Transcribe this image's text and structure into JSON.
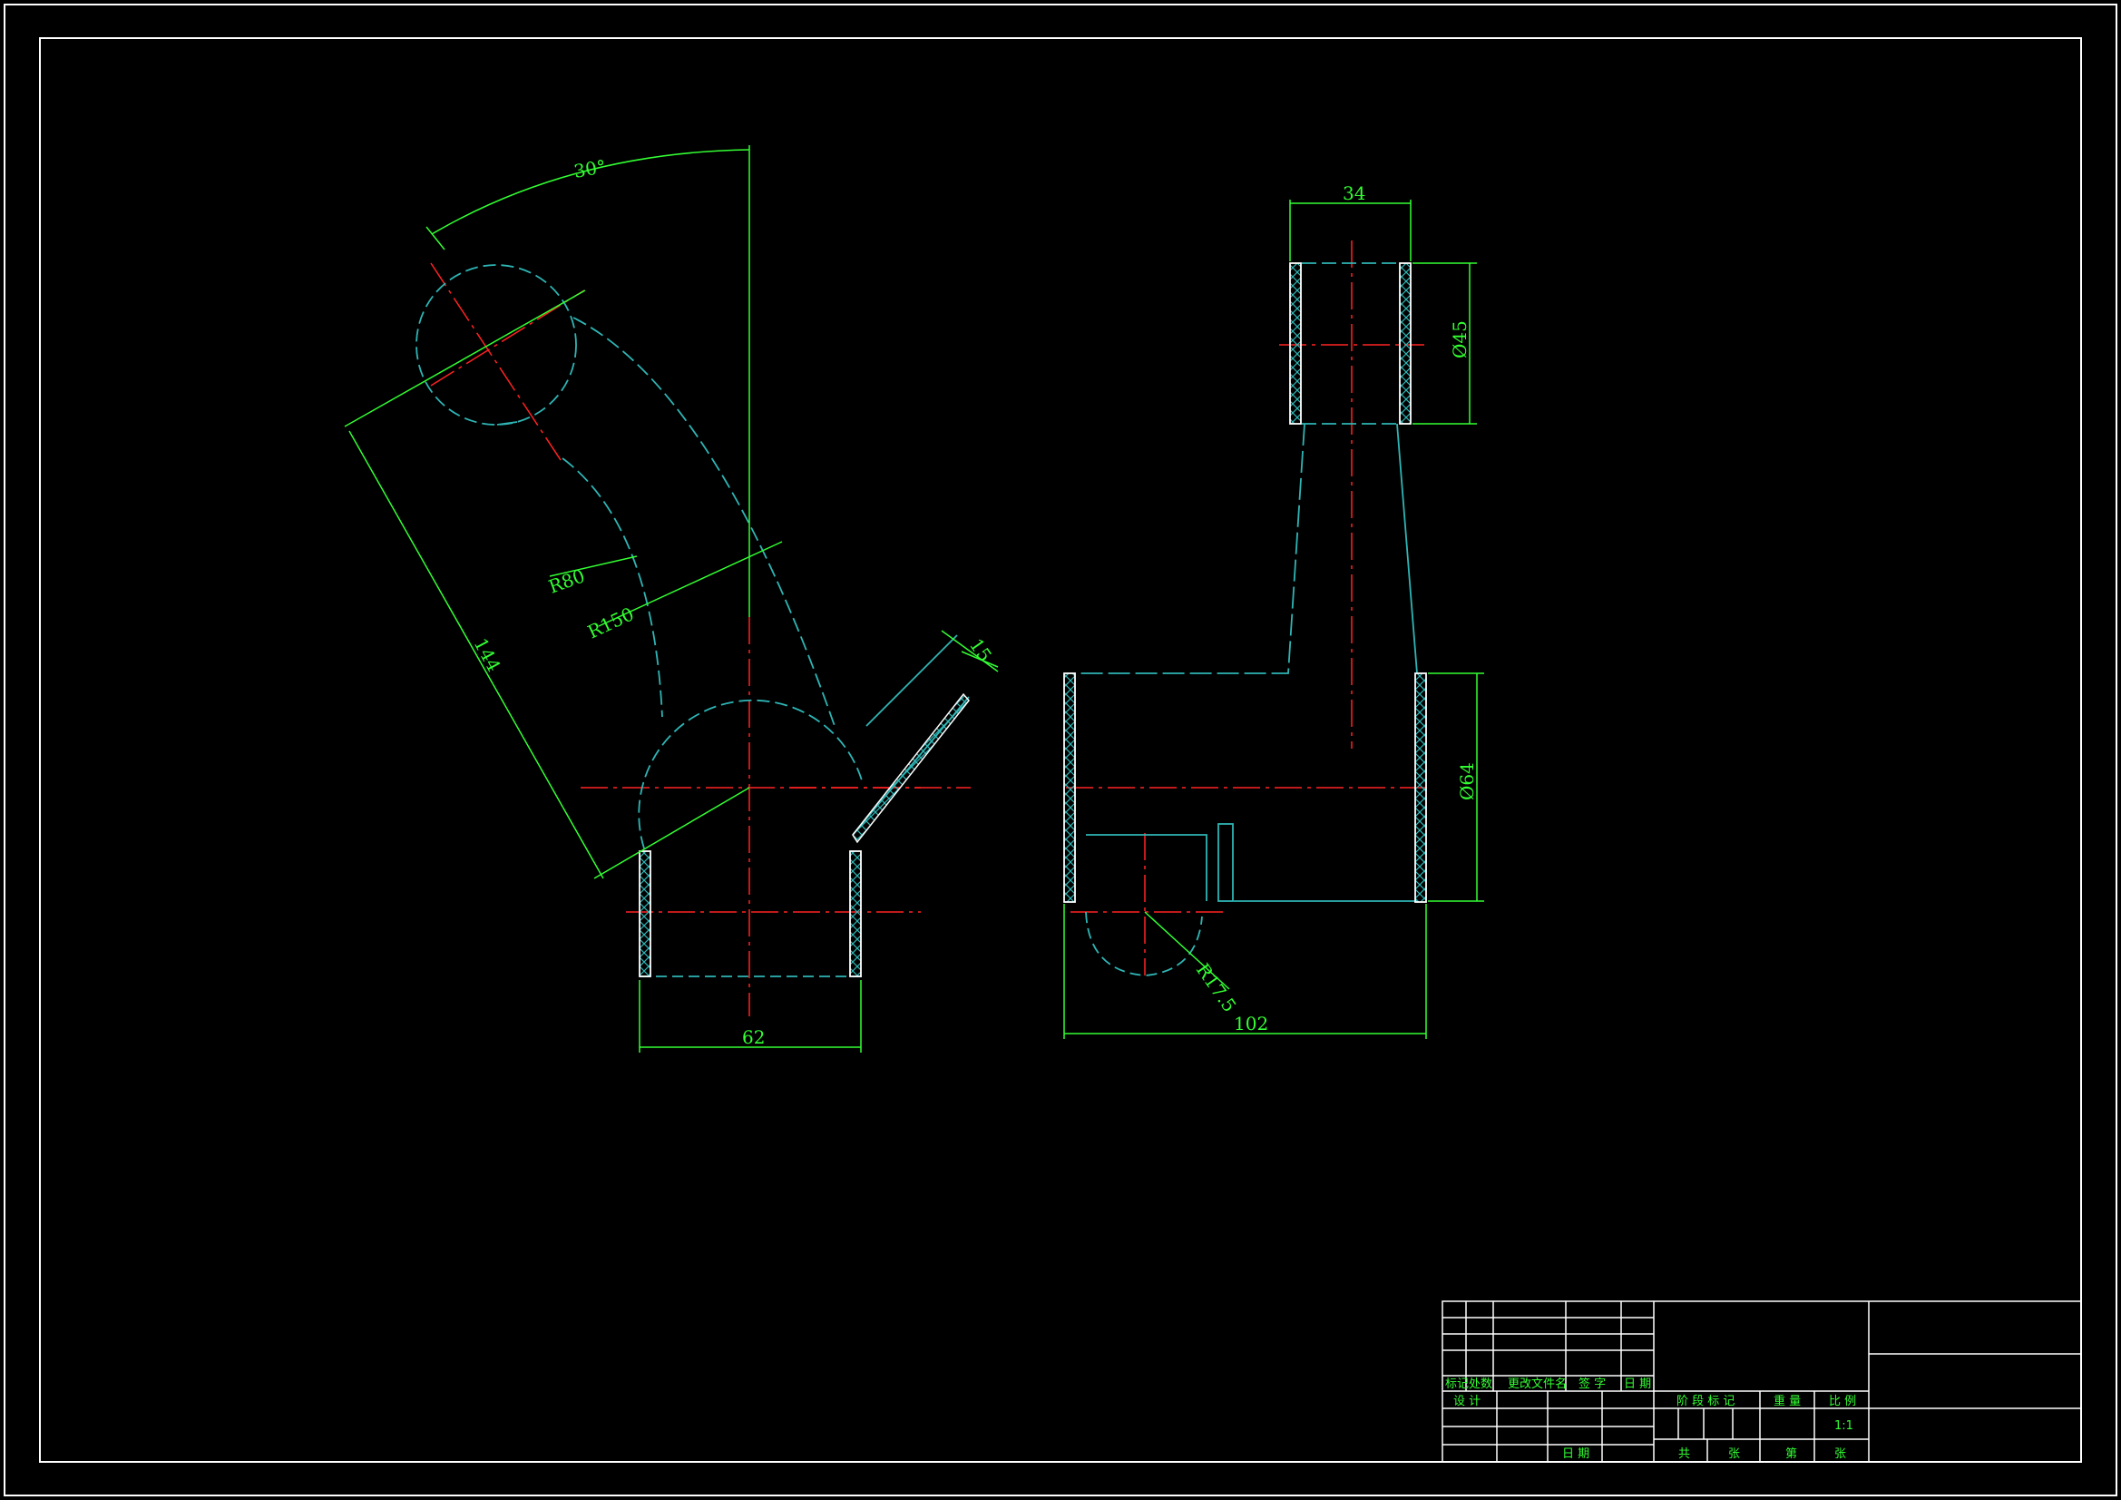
{
  "dimensions": {
    "angle": "30°",
    "r80": "R80",
    "r150": "R150",
    "len144": "144",
    "w15": "15",
    "w62": "62",
    "w34": "34",
    "d45": "Ø45",
    "d64": "Ø64",
    "r17": "R17.5",
    "w102": "102"
  },
  "title_block": {
    "mark": "标记",
    "count": "处数",
    "change_doc": "更改文件名",
    "sign": "签 字",
    "date": "日 期",
    "design": "设 计",
    "stage_mark": "阶 段 标 记",
    "weight": "重 量",
    "scale": "比 例",
    "scale_value": "1:1",
    "date2": "日 期",
    "total": "共",
    "sheets": "张",
    "sheet_no": "第",
    "sheet": "张"
  },
  "colors": {
    "background": "#000000",
    "border": "#ffffff",
    "dimension": "#33ff33",
    "outline": "#2fb5b5",
    "centerline": "#ff2222"
  }
}
